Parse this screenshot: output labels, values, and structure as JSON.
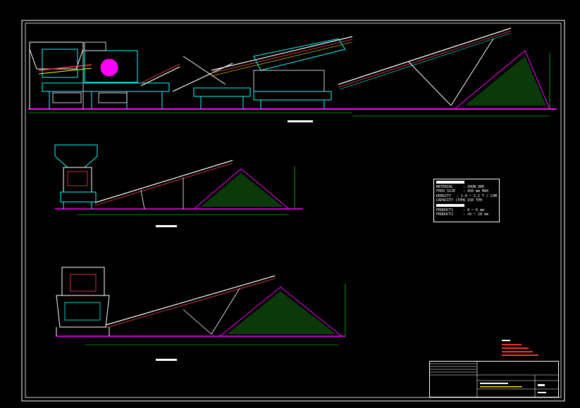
{
  "spec": {
    "rows": [
      {
        "key": "MATERIAL",
        "value": ": IRON ORE"
      },
      {
        "key": "FEED SIZE",
        "value": ": 450 mm MAX"
      },
      {
        "key": "DENSITY",
        "value": ": 1.6 ~ 2.2 T / CUM"
      },
      {
        "key": "CAPACITY (TPH)",
        "value": ": 150 TPH"
      }
    ],
    "products": [
      {
        "key": "PRODUCT1",
        "value": ": 0 ~ 6 mm"
      },
      {
        "key": "PRODUCT2",
        "value": ": +6 ~ 18 mm"
      }
    ]
  },
  "colors": {
    "frame": "#ffffff",
    "machine": "#00ffff",
    "ground": "#ff00ff",
    "dimension": "#00ff00",
    "pile": "#22ff22",
    "notes": "#ff3030"
  }
}
